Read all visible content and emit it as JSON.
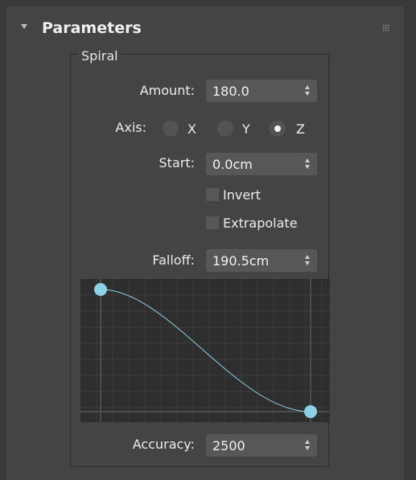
{
  "rollout": {
    "title": "Parameters"
  },
  "spiral": {
    "group_label": "Spiral",
    "amount": {
      "label": "Amount:",
      "value": "180.0"
    },
    "axis": {
      "label": "Axis:",
      "options": [
        {
          "label": "X",
          "selected": false
        },
        {
          "label": "Y",
          "selected": false
        },
        {
          "label": "Z",
          "selected": true
        }
      ]
    },
    "start": {
      "label": "Start:",
      "value": "0.0cm"
    },
    "invert": {
      "label": "Invert",
      "checked": false
    },
    "extrapolate": {
      "label": "Extrapolate",
      "checked": false
    },
    "falloff": {
      "label": "Falloff:",
      "value": "190.5cm"
    },
    "accuracy": {
      "label": "Accuracy:",
      "value": "2500"
    }
  },
  "falloff_curve": {
    "curve_color": "#8cd2e6",
    "grid_color": "#3c3c3c",
    "background": "#2e2e2e"
  }
}
